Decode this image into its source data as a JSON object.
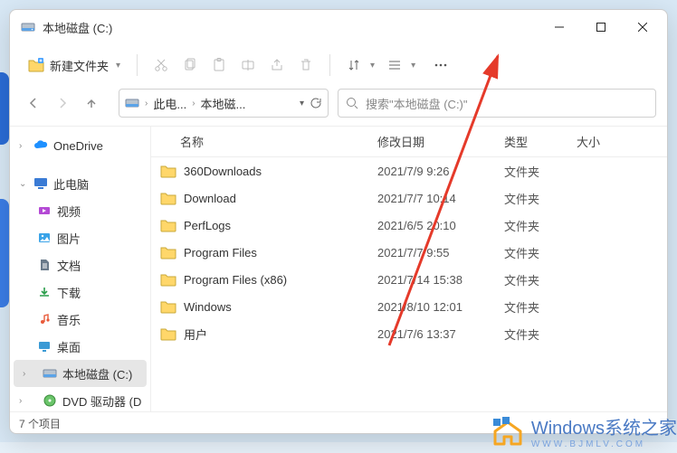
{
  "window": {
    "title": "本地磁盘 (C:)"
  },
  "toolbar": {
    "new_label": "新建文件夹"
  },
  "breadcrumbs": {
    "pc": "此电...",
    "drive": "本地磁..."
  },
  "search": {
    "placeholder": "搜索\"本地磁盘 (C:)\""
  },
  "sidebar": {
    "onedrive": "OneDrive",
    "thispc": "此电脑",
    "video": "视频",
    "pictures": "图片",
    "documents": "文档",
    "downloads": "下载",
    "music": "音乐",
    "desktop": "桌面",
    "drive_c": "本地磁盘 (C:)",
    "dvd": "DVD 驱动器 (D"
  },
  "columns": {
    "name": "名称",
    "date": "修改日期",
    "type": "类型",
    "size": "大小"
  },
  "type_folder": "文件夹",
  "rows": [
    {
      "name": "360Downloads",
      "date": "2021/7/9 9:26"
    },
    {
      "name": "Download",
      "date": "2021/7/7 10:14"
    },
    {
      "name": "PerfLogs",
      "date": "2021/6/5 20:10"
    },
    {
      "name": "Program Files",
      "date": "2021/7/7 9:55"
    },
    {
      "name": "Program Files (x86)",
      "date": "2021/7/14 15:38"
    },
    {
      "name": "Windows",
      "date": "2021/8/10 12:01"
    },
    {
      "name": "用户",
      "date": "2021/7/6 13:37"
    }
  ],
  "status": "7 个项目",
  "watermark": {
    "big": "Windows",
    "tail": "系统之家",
    "sub": "WWW.BJMLV.COM"
  }
}
